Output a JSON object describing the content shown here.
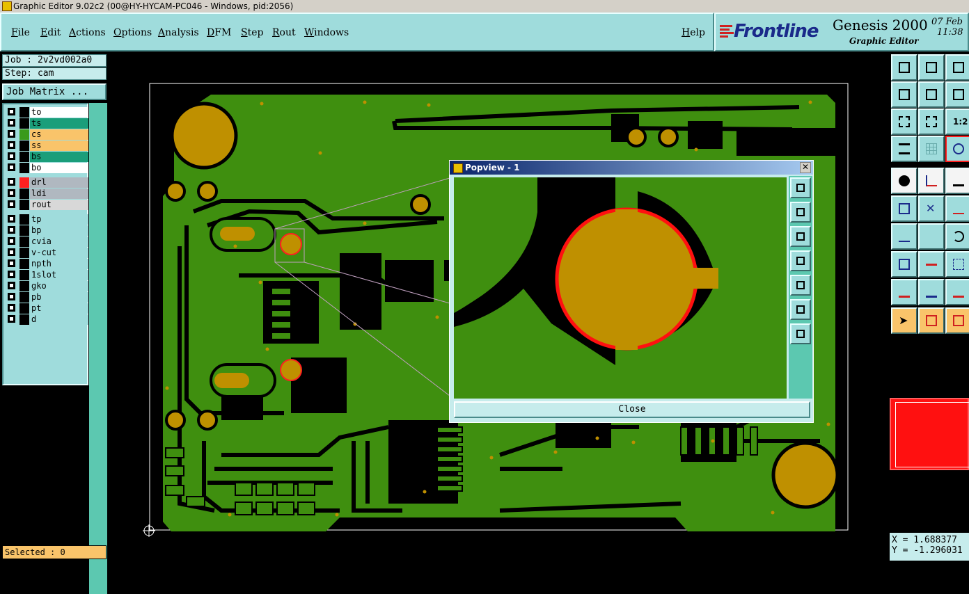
{
  "window": {
    "title": "Graphic Editor 9.02c2 (00@HY-HYCAM-PC046 - Windows, pid:2056)"
  },
  "menu": {
    "items": [
      "File",
      "Edit",
      "Actions",
      "Options",
      "Analysis",
      "DFM",
      "Step",
      "Rout",
      "Windows"
    ],
    "help": "Help"
  },
  "logo": {
    "brand": "Frontline",
    "product": "Genesis 2000",
    "subtitle": "Graphic Editor",
    "date_line1": "07 Feb",
    "date_line2": "11:38"
  },
  "job": {
    "job_label": "Job : 2v2vd002a0",
    "step_label": "Step: cam",
    "matrix_button": "Job Matrix ..."
  },
  "layers": [
    {
      "name": "to",
      "color": "#ffffff",
      "swatch": "#000000"
    },
    {
      "name": "ts",
      "color": "#1a9e7a",
      "swatch": "#000000"
    },
    {
      "name": "cs",
      "color": "#f9c46a",
      "swatch": "#3a9a1a"
    },
    {
      "name": "ss",
      "color": "#f9c46a",
      "swatch": "#000000"
    },
    {
      "name": "bs",
      "color": "#1a9e7a",
      "swatch": "#000000"
    },
    {
      "name": "bo",
      "color": "#ffffff",
      "swatch": "#000000"
    },
    {
      "name": "drl",
      "color": "#b0b8c0",
      "swatch": "#ff2020"
    },
    {
      "name": "ldi",
      "color": "#b0b8c0",
      "swatch": "#000000"
    },
    {
      "name": "rout",
      "color": "#d8d8d8",
      "swatch": "#000000"
    },
    {
      "name": "tp",
      "color": "#9fdcdc",
      "swatch": "#000000"
    },
    {
      "name": "bp",
      "color": "#9fdcdc",
      "swatch": "#000000"
    },
    {
      "name": "cvia",
      "color": "#9fdcdc",
      "swatch": "#000000"
    },
    {
      "name": "v-cut",
      "color": "#9fdcdc",
      "swatch": "#000000"
    },
    {
      "name": "npth",
      "color": "#9fdcdc",
      "swatch": "#000000"
    },
    {
      "name": "1slot",
      "color": "#9fdcdc",
      "swatch": "#000000"
    },
    {
      "name": "gko",
      "color": "#9fdcdc",
      "swatch": "#000000"
    },
    {
      "name": "pb",
      "color": "#9fdcdc",
      "swatch": "#000000"
    },
    {
      "name": "pt",
      "color": "#9fdcdc",
      "swatch": "#000000"
    },
    {
      "name": "d",
      "color": "#9fdcdc",
      "swatch": "#000000"
    }
  ],
  "status": {
    "selected": "Selected : 0"
  },
  "popview": {
    "title": "Popview - 1",
    "close_label": "Close"
  },
  "coords": {
    "x": "X = 1.688377",
    "y": "Y = -1.296031"
  },
  "colors": {
    "board": "#3f8f0f",
    "pad": "#bf9000",
    "accent": "#9fdcdc",
    "highlight": "#ff1010"
  }
}
